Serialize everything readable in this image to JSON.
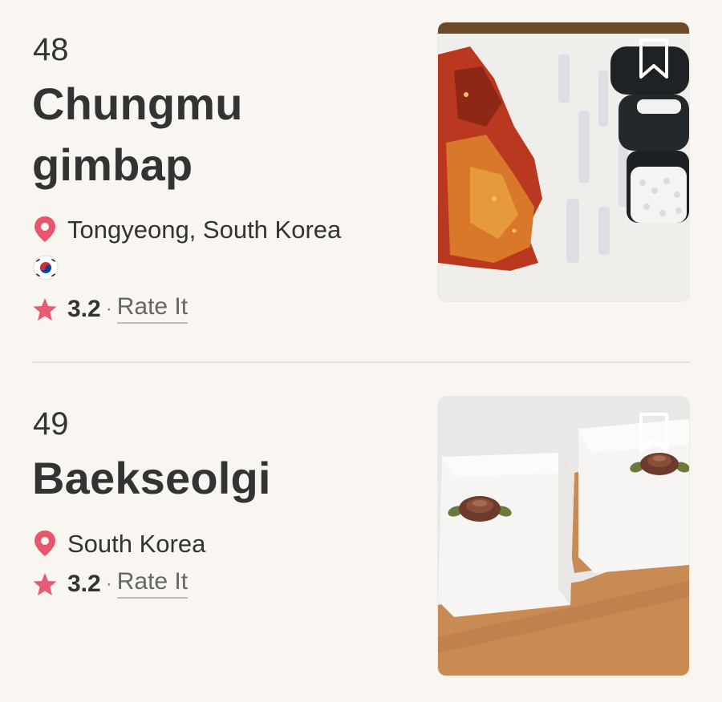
{
  "items": [
    {
      "rank": "48",
      "title": "Chungmu gimbap",
      "location": "Tongyeong, South Korea",
      "flag": "south-korea-flag",
      "rating": "3.2",
      "separator": "·",
      "rate_label": "Rate It",
      "photo": "chungmu-gimbap-photo",
      "bookmark": "bookmark-icon"
    },
    {
      "rank": "49",
      "title": "Baekseolgi",
      "location": "South Korea",
      "rating": "3.2",
      "separator": "·",
      "rate_label": "Rate It",
      "photo": "baekseolgi-photo",
      "bookmark": "bookmark-icon"
    }
  ],
  "colors": {
    "background": "#f9f6f2",
    "text": "#333333",
    "accent_pink": "#e8566b",
    "star": "#e85b74",
    "divider": "#e6e2dd"
  },
  "icons": {
    "pin": "location-pin-icon",
    "star": "star-icon",
    "bookmark": "bookmark-icon"
  }
}
